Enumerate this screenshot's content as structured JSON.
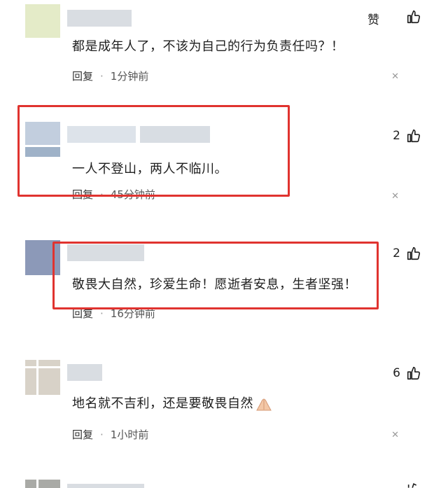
{
  "comments": [
    {
      "text": "都是成年人了，不该为自己的行为负责任吗？！",
      "reply_label": "回复",
      "time": "1分钟前",
      "like_label": "赞"
    },
    {
      "text": "一人不登山，两人不临川。",
      "reply_label": "回复",
      "time": "45分钟前",
      "like_count": "2"
    },
    {
      "text": "敬畏大自然，珍爱生命！愿逝者安息，生者坚强！",
      "reply_label": "回复",
      "time": "16分钟前",
      "like_count": "2"
    },
    {
      "text": "地名就不吉利，还是要敬畏自然",
      "reply_label": "回复",
      "time": "1小时前",
      "like_count": "6"
    }
  ],
  "colors": {
    "highlight_box": "#e0332f",
    "name_placeholder": "#d7dbe0"
  },
  "icons": [
    "thumbs-up-icon",
    "close-icon",
    "praying-hands-icon"
  ]
}
